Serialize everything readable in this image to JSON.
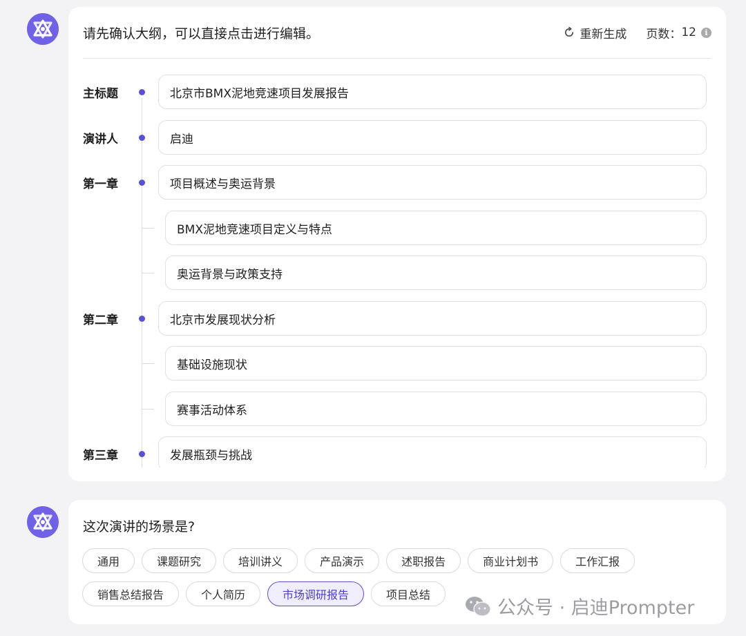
{
  "outline": {
    "prompt": "请先确认大纲，可以直接点击进行编辑。",
    "regenerate_label": "重新生成",
    "pages_label": "页数：",
    "pages_value": "12",
    "info_icon": "i",
    "rows": [
      {
        "label": "主标题",
        "text": "北京市BMX泥地竞速项目发展报告"
      },
      {
        "label": "演讲人",
        "text": "启迪"
      },
      {
        "label": "第一章",
        "text": "项目概述与奥运背景"
      },
      {
        "label": "",
        "text": "BMX泥地竞速项目定义与特点"
      },
      {
        "label": "",
        "text": "奥运背景与政策支持"
      },
      {
        "label": "第二章",
        "text": "北京市发展现状分析"
      },
      {
        "label": "",
        "text": "基础设施现状"
      },
      {
        "label": "",
        "text": "赛事活动体系"
      },
      {
        "label": "第三章",
        "text": "发展瓶颈与挑战"
      }
    ]
  },
  "scene": {
    "question": "这次演讲的场景是?",
    "options": [
      "通用",
      "课题研究",
      "培训讲义",
      "产品演示",
      "述职报告",
      "商业计划书",
      "工作汇报",
      "销售总结报告",
      "个人简历",
      "市场调研报告",
      "项目总结"
    ],
    "selected": "市场调研报告"
  },
  "watermark": {
    "text": "公众号 · 启迪Prompter",
    "icon": "wechat-icon"
  },
  "colors": {
    "accent": "#5b4fd6",
    "avatar": "#6f62e6"
  }
}
